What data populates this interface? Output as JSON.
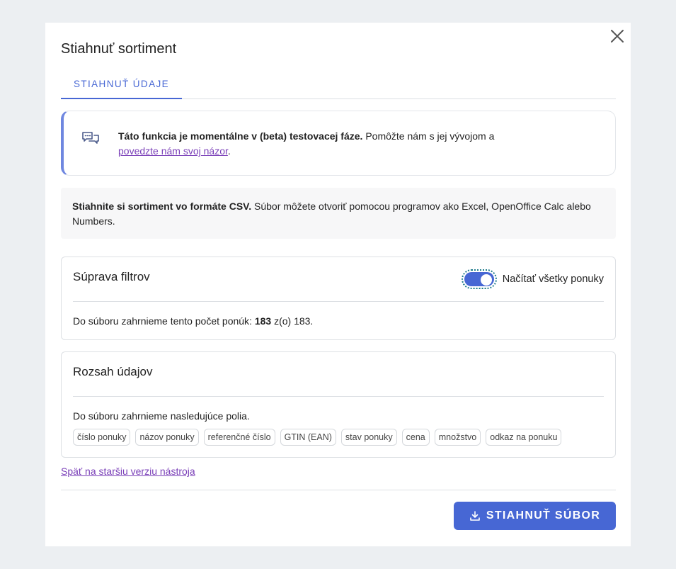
{
  "dialog": {
    "title": "Stiahnuť sortiment",
    "tab_label": "STIAHNUŤ ÚDAJE"
  },
  "beta_notice": {
    "bold_text": "Táto funkcia je momentálne v (beta) testovacej fáze.",
    "text": " Pomôžte nám s jej vývojom a ",
    "link_text": "povedzte nám svoj názor",
    "suffix": "."
  },
  "csv_info": {
    "bold_text": "Stiahnite si sortiment vo formáte CSV.",
    "text": " Súbor môžete otvoriť pomocou programov ako Excel, OpenOffice Calc alebo Numbers."
  },
  "filters_card": {
    "title": "Súprava filtrov",
    "toggle_label": "Načítať všetky ponuky",
    "toggle_on": true,
    "count_prefix": "Do súboru zahrnieme tento počet ponúk: ",
    "count": "183",
    "count_suffix": " z(o) 183."
  },
  "range_card": {
    "title": "Rozsah údajov",
    "fields_text": "Do súboru zahrnieme nasledujúce polia.",
    "fields": [
      "číslo ponuky",
      "názov ponuky",
      "referenčné číslo",
      "GTIN (EAN)",
      "stav ponuky",
      "cena",
      "množstvo",
      "odkaz na ponuku"
    ]
  },
  "old_version_link": "Späť na staršiu verziu nástroja",
  "download_button": "STIAHNUŤ SÚBOR",
  "colors": {
    "accent": "#4767d4",
    "link": "#7a3fb8"
  }
}
